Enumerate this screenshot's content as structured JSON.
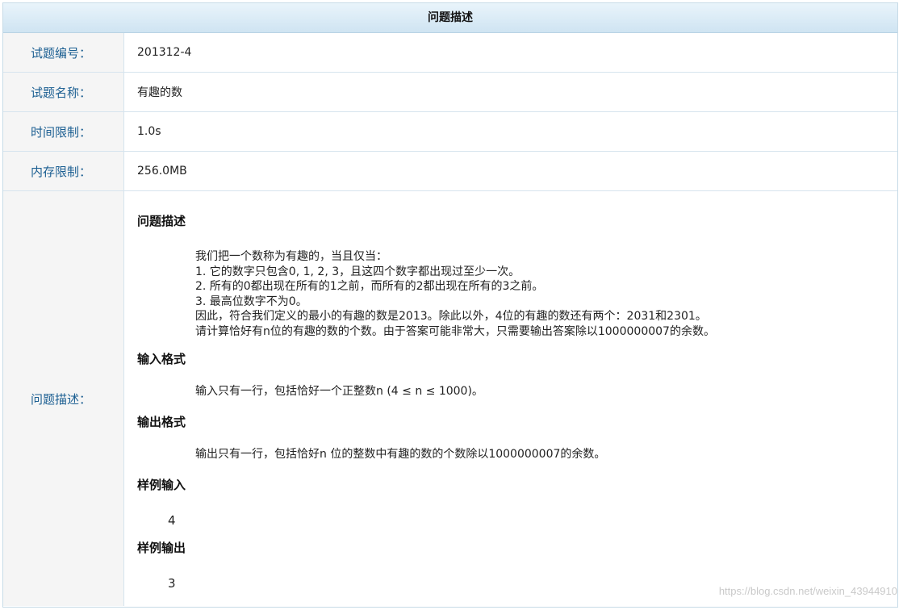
{
  "header": {
    "title": "问题描述"
  },
  "rows": [
    {
      "label": "试题编号：",
      "value": "201312-4"
    },
    {
      "label": "试题名称：",
      "value": "有趣的数"
    },
    {
      "label": "时间限制：",
      "value": "1.0s"
    },
    {
      "label": "内存限制：",
      "value": "256.0MB"
    }
  ],
  "problem": {
    "label": "问题描述：",
    "description_title": "问题描述",
    "description_lines": [
      "我们把一个数称为有趣的，当且仅当：",
      "1. 它的数字只包含0, 1, 2, 3，且这四个数字都出现过至少一次。",
      "2. 所有的0都出现在所有的1之前，而所有的2都出现在所有的3之前。",
      "3. 最高位数字不为0。",
      "因此，符合我们定义的最小的有趣的数是2013。除此以外，4位的有趣的数还有两个：2031和2301。",
      "请计算恰好有n位的有趣的数的个数。由于答案可能非常大，只需要输出答案除以1000000007的余数。"
    ],
    "input_title": "输入格式",
    "input_text": "输入只有一行，包括恰好一个正整数n (4 ≤ n ≤ 1000)。",
    "output_title": "输出格式",
    "output_text": "输出只有一行，包括恰好n 位的整数中有趣的数的个数除以1000000007的余数。",
    "sample_input_title": "样例输入",
    "sample_input": "4",
    "sample_output_title": "样例输出",
    "sample_output": "3"
  },
  "watermark": "https://blog.csdn.net/weixin_43944910"
}
